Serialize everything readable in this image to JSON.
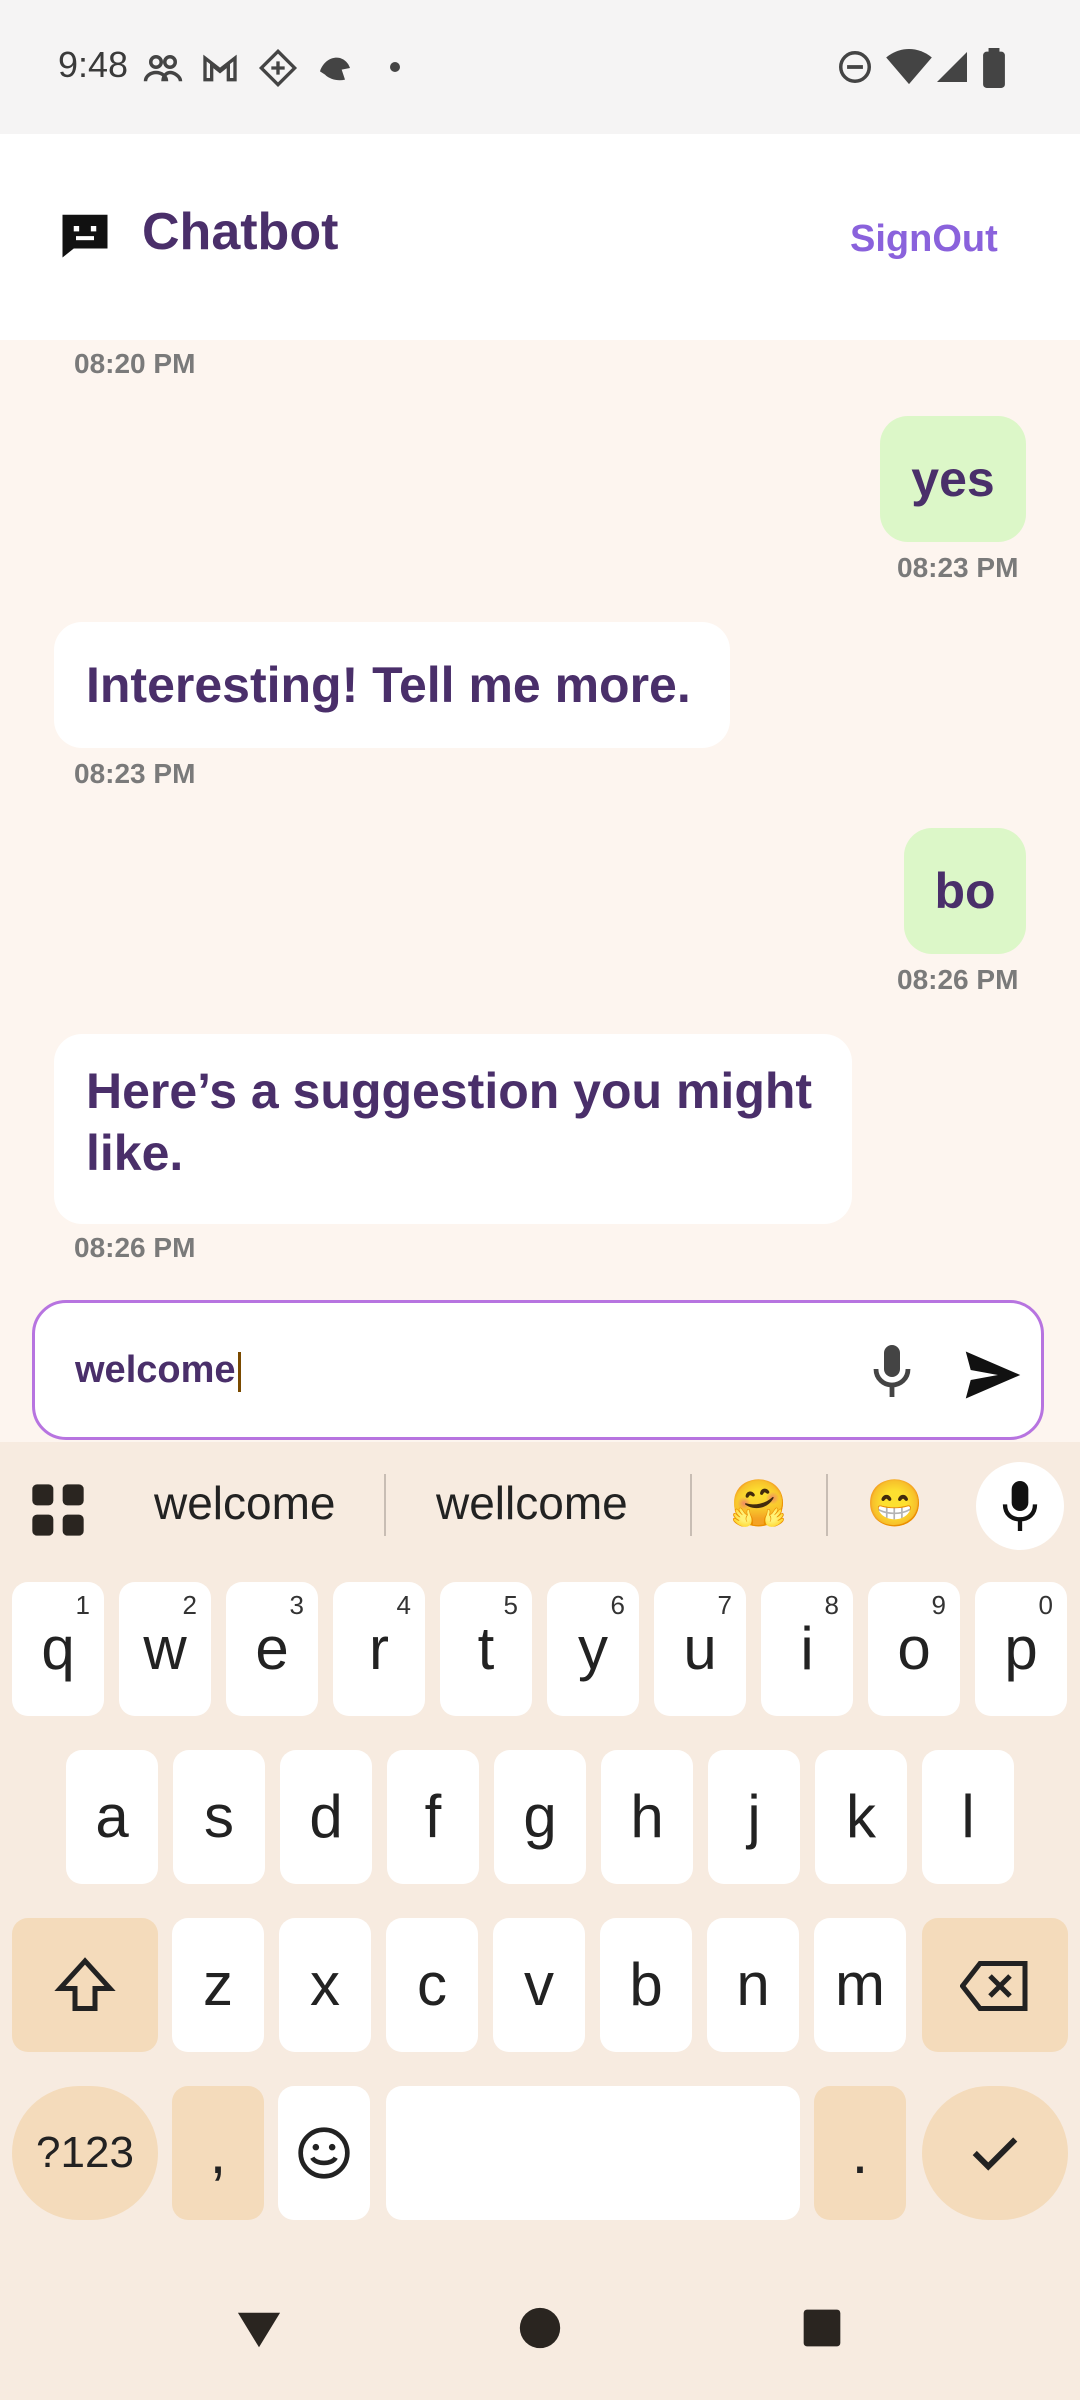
{
  "status_bar": {
    "time": "9:48",
    "icons_left": [
      "people-icon",
      "gmail-icon",
      "app-icon",
      "bird-icon",
      "dot-icon"
    ],
    "icons_right": [
      "dnd-icon",
      "wifi-icon",
      "signal-icon",
      "battery-icon"
    ]
  },
  "header": {
    "title": "Chatbot",
    "signout_label": "SignOut",
    "icon": "chat-icon"
  },
  "messages": [
    {
      "sender": "bot",
      "text": "",
      "time": "08:20 PM"
    },
    {
      "sender": "user",
      "text": "yes",
      "time": "08:23 PM"
    },
    {
      "sender": "bot",
      "text": "Interesting! Tell me more.",
      "time": "08:23 PM"
    },
    {
      "sender": "user",
      "text": "bo",
      "time": "08:26 PM"
    },
    {
      "sender": "bot",
      "text": "Here’s a suggestion you might like.",
      "time": "08:26 PM"
    }
  ],
  "input": {
    "value": "welcome",
    "icons": [
      "mic-icon",
      "send-icon"
    ]
  },
  "keyboard": {
    "suggestions": [
      "welcome",
      "wellcome",
      "🤗",
      "😁"
    ],
    "row1": [
      "q",
      "w",
      "e",
      "r",
      "t",
      "y",
      "u",
      "i",
      "o",
      "p"
    ],
    "row1_hints": [
      "1",
      "2",
      "3",
      "4",
      "5",
      "6",
      "7",
      "8",
      "9",
      "0"
    ],
    "row2": [
      "a",
      "s",
      "d",
      "f",
      "g",
      "h",
      "j",
      "k",
      "l"
    ],
    "row3": [
      "z",
      "x",
      "c",
      "v",
      "b",
      "n",
      "m"
    ],
    "symbols_label": "?123",
    "comma": ",",
    "period": "."
  },
  "colors": {
    "accent": "#8a62dc",
    "title": "#4a2f6a",
    "user_bubble": "#dcf7c8",
    "chat_bg": "#fdf5ef",
    "keyboard_bg": "#f7ebe0"
  }
}
